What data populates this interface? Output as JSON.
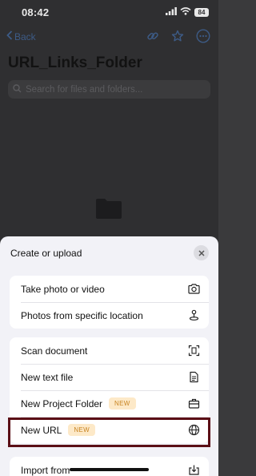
{
  "status_bar": {
    "time": "08:42",
    "battery": "84"
  },
  "nav": {
    "back_label": "Back"
  },
  "page": {
    "title": "URL_Links_Folder",
    "search_placeholder": "Search for files and folders..."
  },
  "sheet": {
    "title": "Create or upload",
    "groups": [
      {
        "items": [
          {
            "label": "Take photo or video",
            "icon": "camera-icon"
          },
          {
            "label": "Photos from specific location",
            "icon": "location-pin-icon"
          }
        ]
      },
      {
        "items": [
          {
            "label": "Scan document",
            "icon": "scan-document-icon"
          },
          {
            "label": "New text file",
            "icon": "text-file-icon"
          },
          {
            "label": "New Project Folder",
            "badge": "NEW",
            "icon": "briefcase-icon"
          },
          {
            "label": "New URL",
            "badge": "NEW",
            "icon": "globe-icon"
          }
        ]
      },
      {
        "items": [
          {
            "label": "Import from",
            "icon": "import-icon"
          }
        ]
      }
    ]
  },
  "colors": {
    "accent_blue": "#3d5b86",
    "badge_bg": "#fde9c8",
    "badge_text": "#c88422",
    "highlight": "#5b0f16"
  }
}
